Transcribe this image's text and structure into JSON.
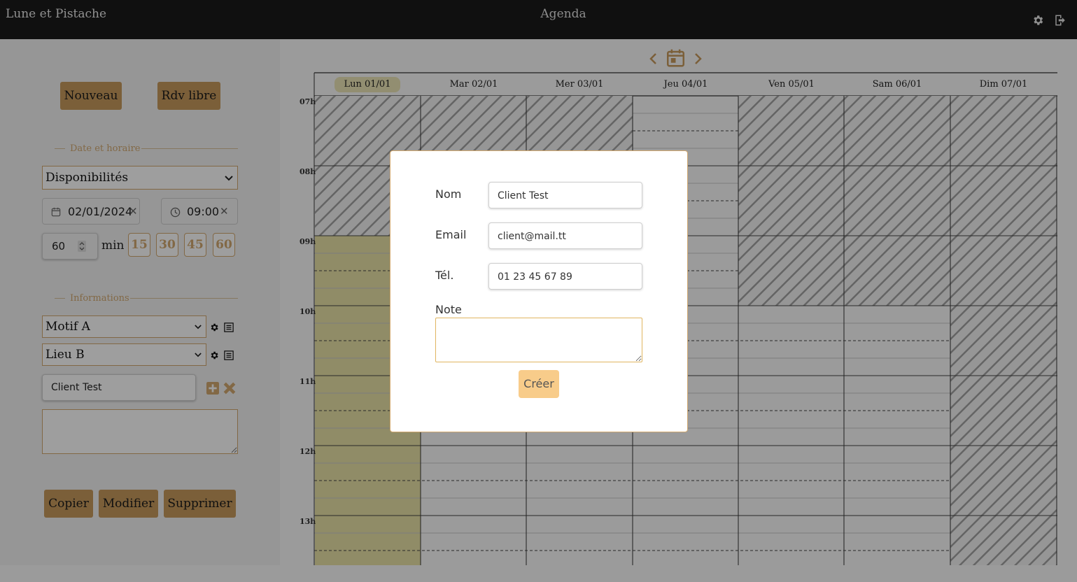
{
  "header": {
    "brand": "Lune et Pistache",
    "title": "Agenda",
    "settings_icon": "gear-icon",
    "logout_icon": "logout-icon"
  },
  "sidebar": {
    "new_button": "Nouveau",
    "free_slot_button": "Rdv libre",
    "date_section": "Date et horaire",
    "availability_select": "Disponibilités",
    "date_value": "02/01/2024",
    "time_value": "09:00",
    "duration_value": "60",
    "duration_unit": "min",
    "duration_presets": [
      "15",
      "30",
      "45",
      "60"
    ],
    "info_section": "Informations",
    "reason_select": "Motif A",
    "place_select": "Lieu B",
    "client_value": "Client Test",
    "copy_button": "Copier",
    "edit_button": "Modifier",
    "delete_button": "Supprimer"
  },
  "calendar": {
    "days": [
      "Lun 01/01",
      "Mar 02/01",
      "Mer 03/01",
      "Jeu 04/01",
      "Ven 05/01",
      "Sam 06/01",
      "Dim 07/01"
    ],
    "hours": [
      "07h",
      "08h",
      "09h",
      "10h",
      "11h",
      "12h",
      "13h"
    ]
  },
  "modal": {
    "name_label": "Nom",
    "name_value": "Client Test",
    "email_label": "Email",
    "email_value": "client@mail.tt",
    "phone_label": "Tél.",
    "phone_value": "01 23 45 67 89",
    "note_label": "Note",
    "create_button": "Créer"
  },
  "colors": {
    "accent": "#c79a5d",
    "accent_light": "#f8cc8a",
    "header_bg": "#1b1b1b",
    "today_bg": "#e9e2a6"
  }
}
